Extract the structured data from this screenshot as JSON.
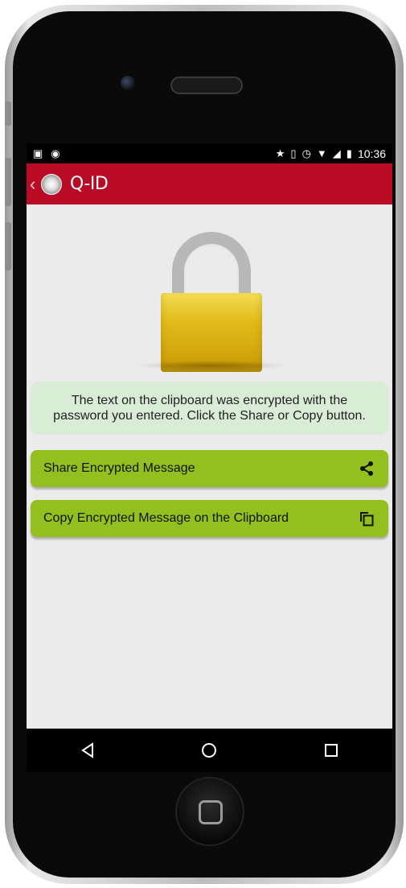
{
  "statusbar": {
    "time": "10:36",
    "icons_left": [
      "image-icon",
      "android-icon"
    ],
    "icons_right": [
      "star-icon",
      "vibrate-icon",
      "alarm-icon",
      "wifi-icon",
      "signal-icon",
      "battery-icon"
    ]
  },
  "appbar": {
    "title": "Q-ID",
    "background": "#b90a26"
  },
  "main": {
    "message": "The text on the clipboard was encrypted with the password you entered. Click the Share or Copy button.",
    "buttons": {
      "share_label": "Share Encrypted Message",
      "copy_label": "Copy Encrypted Message on the Clipboard",
      "color": "#93c01f"
    }
  },
  "navbar": {
    "icons": [
      "back-triangle-icon",
      "home-circle-icon",
      "recents-square-icon"
    ]
  }
}
